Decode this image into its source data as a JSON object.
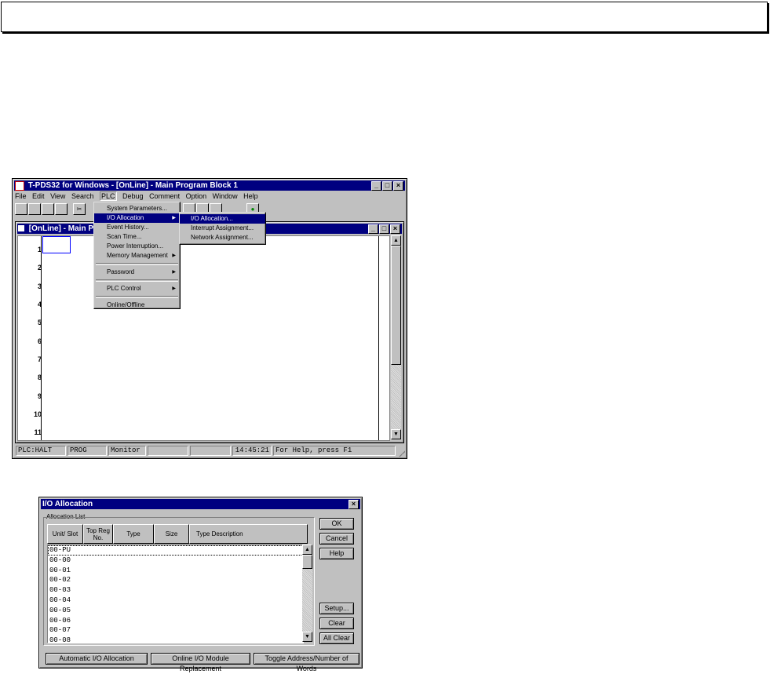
{
  "app_window": {
    "title": "T-PDS32 for Windows - [OnLine] - Main Program Block 1",
    "menu": [
      "File",
      "Edit",
      "View",
      "Search",
      "PLC",
      "Debug",
      "Comment",
      "Option",
      "Window",
      "Help"
    ],
    "plc_menu_items": [
      "System Parameters...",
      "I/O Allocation",
      "Event History...",
      "Scan Time...",
      "Power Interruption...",
      "Memory Management",
      "Password",
      "PLC Control",
      "Online/Offline"
    ],
    "submenu_items": [
      "I/O Allocation...",
      "Interrupt Assignment...",
      "Network Assignment..."
    ],
    "child_title": "[OnLine] - Main Pro",
    "rungs": [
      "1",
      "2",
      "3",
      "4",
      "5",
      "6",
      "7",
      "8",
      "9",
      "10",
      "11"
    ],
    "status": [
      "PLC:HALT",
      "PROG",
      "Monitor",
      "",
      "14:45:21",
      "For Help, press F1"
    ]
  },
  "dialog": {
    "title": "I/O Allocation",
    "group_label": "Allocation List",
    "columns": [
      "Unit/ Slot",
      "Top Reg No.",
      "Type",
      "Size",
      "Type Description"
    ],
    "rows": [
      "00-PU",
      "00-00",
      "00-01",
      "00-02",
      "00-03",
      "00-04",
      "00-05",
      "00-06",
      "00-07",
      "00-08"
    ],
    "buttons": {
      "ok": "OK",
      "cancel": "Cancel",
      "help": "Help",
      "setup": "Setup...",
      "clear": "Clear",
      "all_clear": "All Clear"
    },
    "bottom_buttons": [
      "Automatic I/O Allocation",
      "Online I/O Module Replacement",
      "Toggle Address/Number of Words"
    ]
  },
  "icons": [
    "app-icon",
    "close-icon",
    "minimize-icon",
    "maximize-icon",
    "submenu-arrow-icon",
    "scroll-up-icon",
    "scroll-down-icon",
    "resize-grip-icon"
  ]
}
